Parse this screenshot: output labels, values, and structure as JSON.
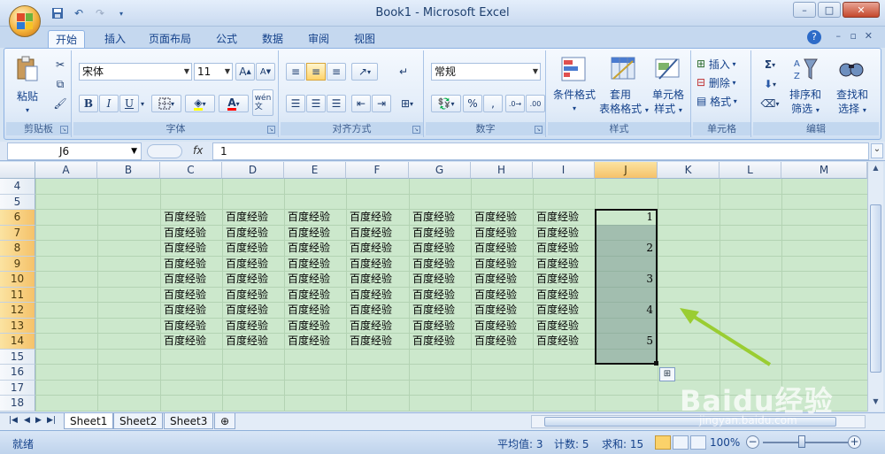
{
  "window": {
    "title": "Book1 - Microsoft Excel",
    "controls": [
      "–",
      "□",
      "×"
    ]
  },
  "qat": [
    "save-icon",
    "undo-icon",
    "redo-icon",
    "customize-icon"
  ],
  "ribbon_tabs": [
    "开始",
    "插入",
    "页面布局",
    "公式",
    "数据",
    "审阅",
    "视图"
  ],
  "ribbon": {
    "clipboard": {
      "paste_label": "粘贴",
      "group_label": "剪贴板"
    },
    "font": {
      "font_name": "宋体",
      "font_size": "11",
      "bold": "B",
      "italic": "I",
      "underline": "U",
      "group_label": "字体",
      "font_color": "#ff0000",
      "fill_color": "#ffff00"
    },
    "alignment": {
      "group_label": "对齐方式"
    },
    "number": {
      "format": "常规",
      "percent": "%",
      "comma": ",",
      "group_label": "数字"
    },
    "styles": {
      "conditional": "条件格式",
      "table": "套用",
      "table2": "表格格式",
      "cell": "单元格",
      "cell2": "样式",
      "group_label": "样式"
    },
    "cells": {
      "insert": "插入",
      "delete": "删除",
      "format": "格式",
      "group_label": "单元格"
    },
    "editing": {
      "sort": "排序和",
      "sort2": "筛选",
      "find": "查找和",
      "find2": "选择",
      "sigma": "Σ",
      "group_label": "编辑"
    }
  },
  "formula_bar": {
    "name_box": "J6",
    "fx": "fx",
    "content": "1"
  },
  "columns": [
    "A",
    "B",
    "C",
    "D",
    "E",
    "F",
    "G",
    "H",
    "I",
    "J",
    "K",
    "L",
    "M"
  ],
  "rows": [
    "4",
    "5",
    "6",
    "7",
    "8",
    "9",
    "10",
    "11",
    "12",
    "13",
    "14",
    "15",
    "16",
    "17",
    "18"
  ],
  "cell_text": "百度经验",
  "j_values": [
    "1",
    "2",
    "3",
    "4",
    "5"
  ],
  "sheets": [
    "Sheet1",
    "Sheet2",
    "Sheet3"
  ],
  "status": {
    "ready": "就绪",
    "average": "平均值: 3",
    "count": "计数: 5",
    "sum": "求和: 15",
    "zoom": "100%"
  },
  "watermark": {
    "brand": "Baidu经验",
    "url": "jingyan.baidu.com"
  },
  "colors": {
    "grid_bg": "#cce8cc",
    "accent_arrow": "#9acd32",
    "selected_header": "#f5c26a"
  }
}
